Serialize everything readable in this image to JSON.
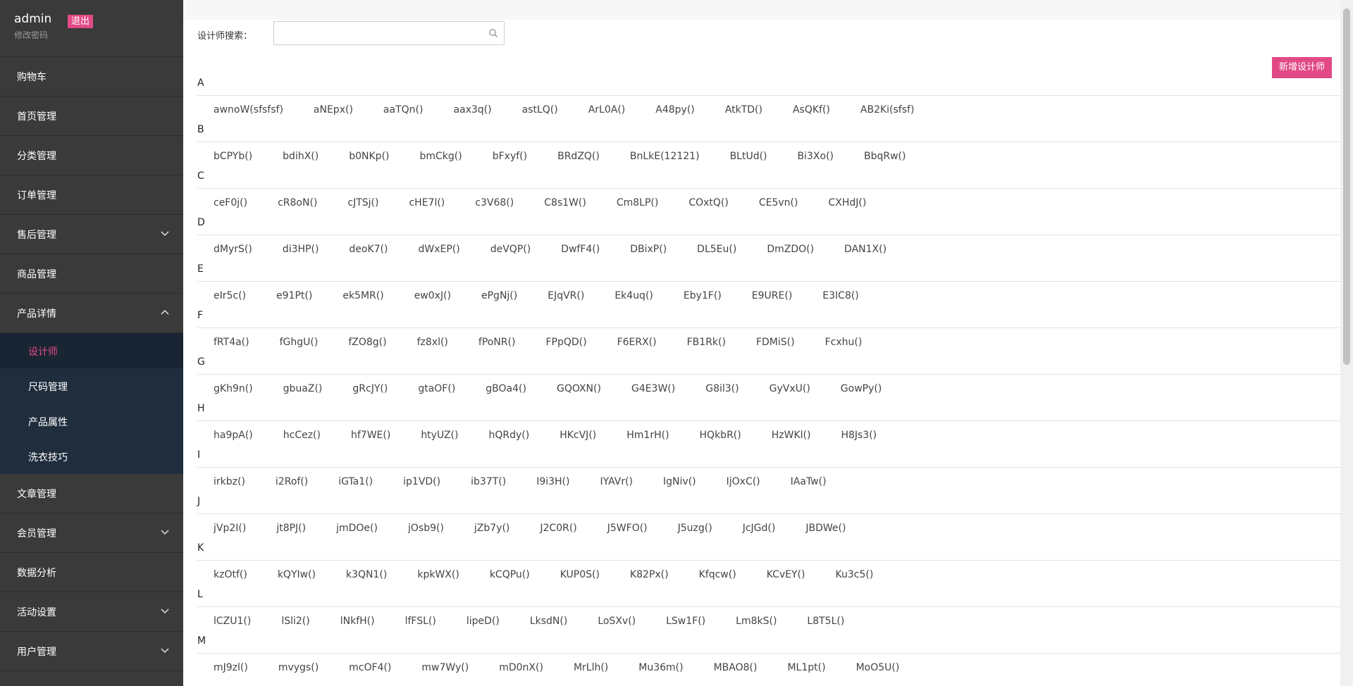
{
  "user": {
    "name": "admin",
    "logout": "退出",
    "change_password": "修改密码"
  },
  "sidebar": {
    "items": [
      {
        "label": "购物车",
        "chevron": ""
      },
      {
        "label": "首页管理",
        "chevron": ""
      },
      {
        "label": "分类管理",
        "chevron": ""
      },
      {
        "label": "订单管理",
        "chevron": ""
      },
      {
        "label": "售后管理",
        "chevron": "down"
      },
      {
        "label": "商品管理",
        "chevron": ""
      },
      {
        "label": "产品详情",
        "chevron": "up"
      },
      {
        "label": "文章管理",
        "chevron": ""
      },
      {
        "label": "会员管理",
        "chevron": "down"
      },
      {
        "label": "数据分析",
        "chevron": ""
      },
      {
        "label": "活动设置",
        "chevron": "down"
      },
      {
        "label": "用户管理",
        "chevron": "down"
      }
    ],
    "submenu": [
      {
        "label": "设计师",
        "active": true
      },
      {
        "label": "尺码管理",
        "active": false
      },
      {
        "label": "产品属性",
        "active": false
      },
      {
        "label": "洗衣技巧",
        "active": false
      }
    ]
  },
  "search": {
    "label": "设计师搜索：",
    "value": "",
    "placeholder": ""
  },
  "add_button": "新增设计师",
  "colors": {
    "accent": "#e14a86",
    "sidebar_bg": "#3a3a3a",
    "submenu_bg": "#1f2d3d"
  },
  "groups": [
    {
      "letter": "A",
      "names": [
        "awnoW(sfsfsf)",
        "aNEpx()",
        "aaTQn()",
        "aax3q()",
        "astLQ()",
        "ArL0A()",
        "A48py()",
        "AtkTD()",
        "AsQKf()",
        "AB2Ki(sfsf)"
      ]
    },
    {
      "letter": "B",
      "names": [
        "bCPYb()",
        "bdihX()",
        "b0NKp()",
        "bmCkg()",
        "bFxyf()",
        "BRdZQ()",
        "BnLkE(12121)",
        "BLtUd()",
        "Bi3Xo()",
        "BbqRw()"
      ]
    },
    {
      "letter": "C",
      "names": [
        "ceF0j()",
        "cR8oN()",
        "cJTSj()",
        "cHE7l()",
        "c3V68()",
        "C8s1W()",
        "Cm8LP()",
        "COxtQ()",
        "CE5vn()",
        "CXHdJ()"
      ]
    },
    {
      "letter": "D",
      "names": [
        "dMyrS()",
        "di3HP()",
        "deoK7()",
        "dWxEP()",
        "deVQP()",
        "DwfF4()",
        "DBixP()",
        "DL5Eu()",
        "DmZDO()",
        "DAN1X()"
      ]
    },
    {
      "letter": "E",
      "names": [
        "eIr5c()",
        "e91Pt()",
        "ek5MR()",
        "ew0xJ()",
        "ePgNj()",
        "EJqVR()",
        "Ek4uq()",
        "Eby1F()",
        "E9URE()",
        "E3IC8()"
      ]
    },
    {
      "letter": "F",
      "names": [
        "fRT4a()",
        "fGhgU()",
        "fZO8g()",
        "fz8xl()",
        "fPoNR()",
        "FPpQD()",
        "F6ERX()",
        "FB1Rk()",
        "FDMiS()",
        "Fcxhu()"
      ]
    },
    {
      "letter": "G",
      "names": [
        "gKh9n()",
        "gbuaZ()",
        "gRcJY()",
        "gtaOF()",
        "gBOa4()",
        "GQOXN()",
        "G4E3W()",
        "G8il3()",
        "GyVxU()",
        "GowPy()"
      ]
    },
    {
      "letter": "H",
      "names": [
        "ha9pA()",
        "hcCez()",
        "hf7WE()",
        "htyUZ()",
        "hQRdy()",
        "HKcVJ()",
        "Hm1rH()",
        "HQkbR()",
        "HzWKl()",
        "H8Js3()"
      ]
    },
    {
      "letter": "I",
      "names": [
        "irkbz()",
        "i2Rof()",
        "iGTa1()",
        "ip1VD()",
        "ib37T()",
        "I9i3H()",
        "IYAVr()",
        "IgNiv()",
        "IjOxC()",
        "IAaTw()"
      ]
    },
    {
      "letter": "J",
      "names": [
        "jVp2I()",
        "jt8PJ()",
        "jmDOe()",
        "jOsb9()",
        "jZb7y()",
        "J2C0R()",
        "J5WFO()",
        "J5uzg()",
        "JcJGd()",
        "JBDWe()"
      ]
    },
    {
      "letter": "K",
      "names": [
        "kzOtf()",
        "kQYIw()",
        "k3QN1()",
        "kpkWX()",
        "kCQPu()",
        "KUP0S()",
        "K82Px()",
        "Kfqcw()",
        "KCvEY()",
        "Ku3c5()"
      ]
    },
    {
      "letter": "L",
      "names": [
        "lCZU1()",
        "lSli2()",
        "lNkfH()",
        "lfFSL()",
        "lipeD()",
        "LksdN()",
        "LoSXv()",
        "LSw1F()",
        "Lm8kS()",
        "L8T5L()"
      ]
    },
    {
      "letter": "M",
      "names": [
        "mJ9zl()",
        "mvygs()",
        "mcOF4()",
        "mw7Wy()",
        "mD0nX()",
        "MrLlh()",
        "Mu36m()",
        "MBAO8()",
        "ML1pt()",
        "MoO5U()"
      ]
    }
  ]
}
